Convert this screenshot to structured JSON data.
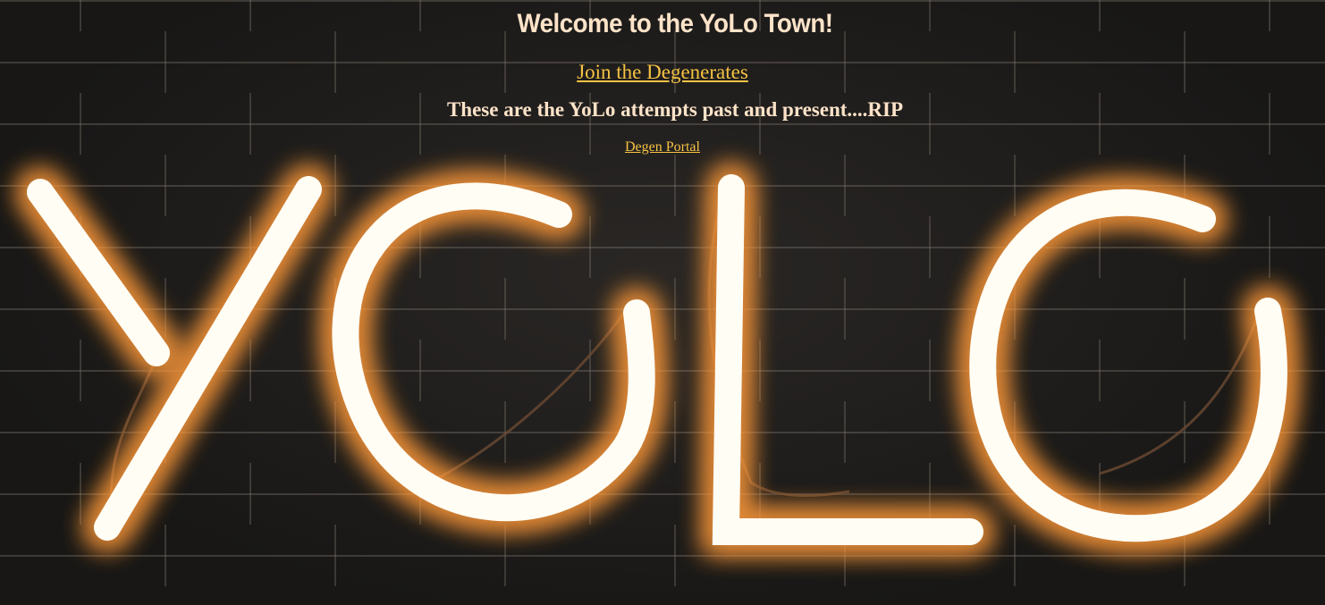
{
  "page": {
    "title": "Welcome to the YoLo Town!",
    "join_link": "Join the Degenerates",
    "subtitle": "These are the YoLo attempts past and present....RIP",
    "portal_link": "Degen Portal"
  },
  "background": {
    "image": "neon YoLo sign on brick wall",
    "neon_letters": "YOLO"
  },
  "colors": {
    "heading": "#fde3c8",
    "link": "#f6c244",
    "neon_core": "#fffdf4",
    "neon_glow": "#ff9a3a",
    "wall": "#1e1c1b"
  }
}
